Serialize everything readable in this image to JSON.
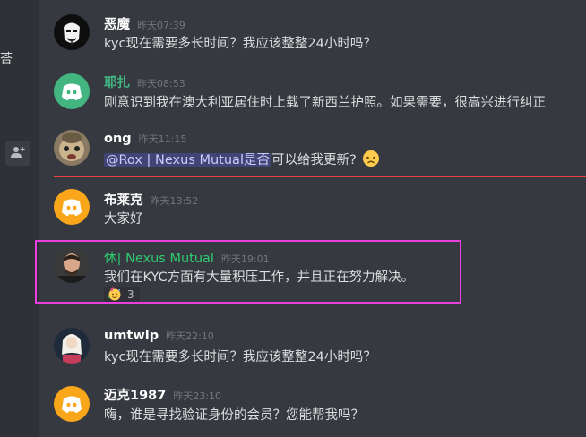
{
  "sidebar": {
    "partial_text": "荅",
    "add_member_icon": "person-plus-icon"
  },
  "messages": [
    {
      "author": "恶魔",
      "time": "昨天07:39",
      "text": "kyc现在需要多长时间？我应该整整24小时吗？"
    },
    {
      "author": "耶扎",
      "time": "昨天08:53",
      "text": "刚意识到我在澳大利亚居住时上载了新西兰护照。如果需要，很高兴进行纠正"
    },
    {
      "author": "ong",
      "time": "昨天11:15",
      "mention": "@Rox | Nexus Mutual是否",
      "text": "可以给我更新?",
      "emoji": "crying-face"
    },
    {
      "author": "布莱克",
      "time": "昨天13:52",
      "text": "大家好"
    },
    {
      "author": "休| Nexus Mutual",
      "time": "昨天19:01",
      "text": "我们在KYC方面有大量积压工作，并且正在努力解决。",
      "reaction": {
        "emoji": "party-face",
        "count": "3"
      }
    },
    {
      "author": "umtwlp",
      "time": "昨天22:10",
      "text": "kyc现在需要多长时间？我应该整整24小时吗？"
    },
    {
      "author": "迈克1987",
      "time": "昨天23:10",
      "text": "嗨，谁是寻找验证身份的会员？您能帮我吗？"
    }
  ],
  "colors": {
    "background": "#36393f",
    "sidebar": "#2f3136",
    "discord_green": "#43b581",
    "discord_orange": "#faa61a",
    "highlight_border": "#e93fe0",
    "new_divider": "#ed4245",
    "team_name": "#2ecc71"
  }
}
